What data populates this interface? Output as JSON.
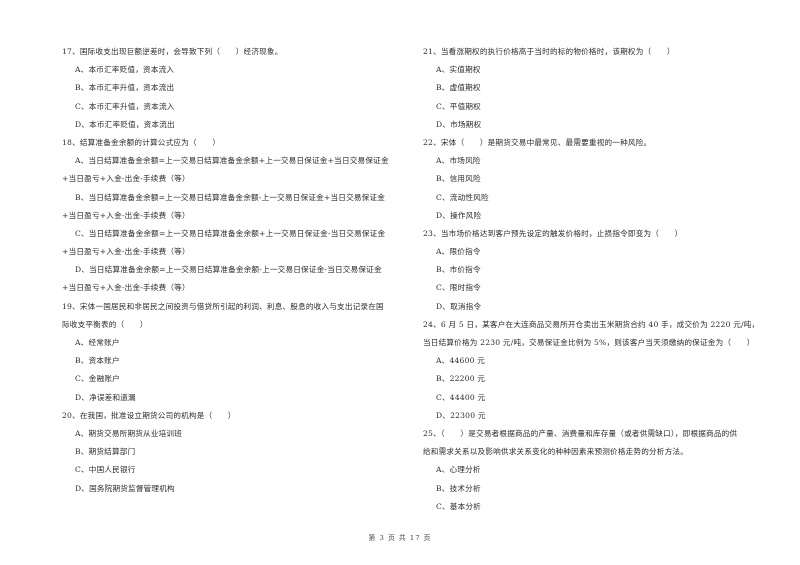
{
  "page": {
    "footer": "第 3 页 共 17 页"
  },
  "left_column": [
    {
      "type": "q",
      "text": "17、国际收支出现巨额逆差时，会导致下列（　　）经济现象。"
    },
    {
      "type": "opt",
      "text": "A、本币汇率贬值，资本流入"
    },
    {
      "type": "opt",
      "text": "B、本币汇率升值，资本流出"
    },
    {
      "type": "opt",
      "text": "C、本币汇率升值，资本流入"
    },
    {
      "type": "opt",
      "text": "D、本币汇率贬值，资本流出"
    },
    {
      "type": "q",
      "text": "18、结算准备金余额的计算公式应为（　　）"
    },
    {
      "type": "opt",
      "text": "A、当日结算准备金余额=上一交易日结算准备金余额+上一交易日保证金+当日交易保证金"
    },
    {
      "type": "cont",
      "text": "+当日盈亏+入金-出金-手续费（等）"
    },
    {
      "type": "opt",
      "text": "B、当日结算准备金余额=上一交易日结算准备金余额-上一交易日保证金+当日交易保证金"
    },
    {
      "type": "cont",
      "text": "+当日盈亏+入金-出金-手续费（等）"
    },
    {
      "type": "opt",
      "text": "C、当日结算准备金余额=上一交易日结算准备金余额+上一交易日保证金-当日交易保证金"
    },
    {
      "type": "cont",
      "text": "+当日盈亏+入金-出金-手续费（等）"
    },
    {
      "type": "opt",
      "text": "D、当日结算准备金余额=上一交易日结算准备金余额-上一交易日保证金-当日交易保证金"
    },
    {
      "type": "cont",
      "text": "+当日盈亏+入金-出金-手续费（等）"
    },
    {
      "type": "q",
      "text": "19、宋体一国居民和非居民之间投资与借贷所引起的利润、利息、股息的收入与支出记录在国"
    },
    {
      "type": "cont",
      "text": "际收支平衡表的（　　）"
    },
    {
      "type": "opt",
      "text": "A、经常账户"
    },
    {
      "type": "opt",
      "text": "B、资本账户"
    },
    {
      "type": "opt",
      "text": "C、金融账户"
    },
    {
      "type": "opt",
      "text": "D、净误差和遗漏"
    },
    {
      "type": "q",
      "text": "20、在我国，批准设立期货公司的机构是（　　）"
    },
    {
      "type": "opt",
      "text": "A、期货交易所期货从业培训班"
    },
    {
      "type": "opt",
      "text": "B、期货结算部门"
    },
    {
      "type": "opt",
      "text": "C、中国人民银行"
    },
    {
      "type": "opt",
      "text": "D、国务院期货监督管理机构"
    }
  ],
  "right_column": [
    {
      "type": "q",
      "text": "21、当看涨期权的执行价格高于当时的标的物价格时，该期权为（　　）"
    },
    {
      "type": "opt",
      "text": "A、实值期权"
    },
    {
      "type": "opt",
      "text": "B、虚值期权"
    },
    {
      "type": "opt",
      "text": "C、平值期权"
    },
    {
      "type": "opt",
      "text": "D、市场期权"
    },
    {
      "type": "q",
      "text": "22、宋体（　　）是期货交易中最常见、最需要重视的一种风险。"
    },
    {
      "type": "opt",
      "text": "A、市场风险"
    },
    {
      "type": "opt",
      "text": "B、信用风险"
    },
    {
      "type": "opt",
      "text": "C、流动性风险"
    },
    {
      "type": "opt",
      "text": "D、操作风险"
    },
    {
      "type": "q",
      "text": "23、当市场价格达到客户预先设定的触发价格时，止损指令即变为（　　）"
    },
    {
      "type": "opt",
      "text": "A、限价指令"
    },
    {
      "type": "opt",
      "text": "B、市价指令"
    },
    {
      "type": "opt",
      "text": "C、限时指令"
    },
    {
      "type": "opt",
      "text": "D、取消指令"
    },
    {
      "type": "q",
      "text": "24、6 月 5 日，某客户在大连商品交易所开仓卖出玉米期货合约 40 手，成交价为 2220 元/吨，"
    },
    {
      "type": "cont",
      "text": "当日结算价格为 2230 元/吨，交易保证金比例为 5%，则该客户当天须缴纳的保证金为（　　）"
    },
    {
      "type": "opt",
      "text": "A、44600 元"
    },
    {
      "type": "opt",
      "text": "B、22200 元"
    },
    {
      "type": "opt",
      "text": "C、44400 元"
    },
    {
      "type": "opt",
      "text": "D、22300 元"
    },
    {
      "type": "q",
      "text": "25、（　　）是交易者根据商品的产量、消费量和库存量（或者供需缺口），即根据商品的供"
    },
    {
      "type": "cont",
      "text": "给和需求关系以及影响供求关系变化的种种因素来预测价格走势的分析方法。"
    },
    {
      "type": "opt",
      "text": "A、心理分析"
    },
    {
      "type": "opt",
      "text": "B、技术分析"
    },
    {
      "type": "opt",
      "text": "C、基本分析"
    }
  ]
}
